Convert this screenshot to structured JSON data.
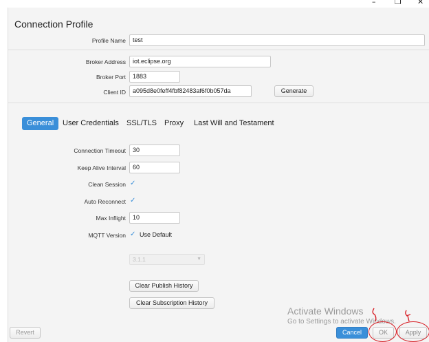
{
  "window": {
    "minimize_glyph": "–",
    "restore_glyph": "❐",
    "close_glyph": "✕"
  },
  "header": {
    "title": "Connection Profile"
  },
  "profile": {
    "profile_name_label": "Profile Name",
    "profile_name_value": "test"
  },
  "broker": {
    "address_label": "Broker Address",
    "address_value": "iot.eclipse.org",
    "port_label": "Broker Port",
    "port_value": "1883",
    "client_id_label": "Client ID",
    "client_id_value": "a095d8e0feff4fbf82483af6f0b057da",
    "generate_label": "Generate"
  },
  "tabs": [
    {
      "label": "General",
      "active": true
    },
    {
      "label": "User Credentials",
      "active": false
    },
    {
      "label": "SSL/TLS",
      "active": false
    },
    {
      "label": "Proxy",
      "active": false
    },
    {
      "label": "Last Will and Testament",
      "active": false
    }
  ],
  "general": {
    "connection_timeout_label": "Connection Timeout",
    "connection_timeout_value": "30",
    "keep_alive_label": "Keep Alive Interval",
    "keep_alive_value": "60",
    "clean_session_label": "Clean Session",
    "clean_session_checked": true,
    "auto_reconnect_label": "Auto Reconnect",
    "auto_reconnect_checked": true,
    "max_inflight_label": "Max Inflight",
    "max_inflight_value": "10",
    "mqtt_version_label": "MQTT Version",
    "use_default_label": "Use Default",
    "use_default_checked": true,
    "mqtt_version_value": "3.1.1",
    "clear_publish_label": "Clear Publish History",
    "clear_subscription_label": "Clear Subscription History"
  },
  "footer": {
    "revert_label": "Revert",
    "cancel_label": "Cancel",
    "ok_label": "OK",
    "apply_label": "Apply"
  },
  "watermark": {
    "line1": "Activate Windows",
    "line2": "Go to Settings to activate Windows."
  },
  "colors": {
    "accent": "#3a8fd9",
    "annotation": "#d81f26",
    "panel_bg": "#f4f4f4"
  },
  "icons": {
    "check": "✓",
    "dropdown": "▼"
  }
}
